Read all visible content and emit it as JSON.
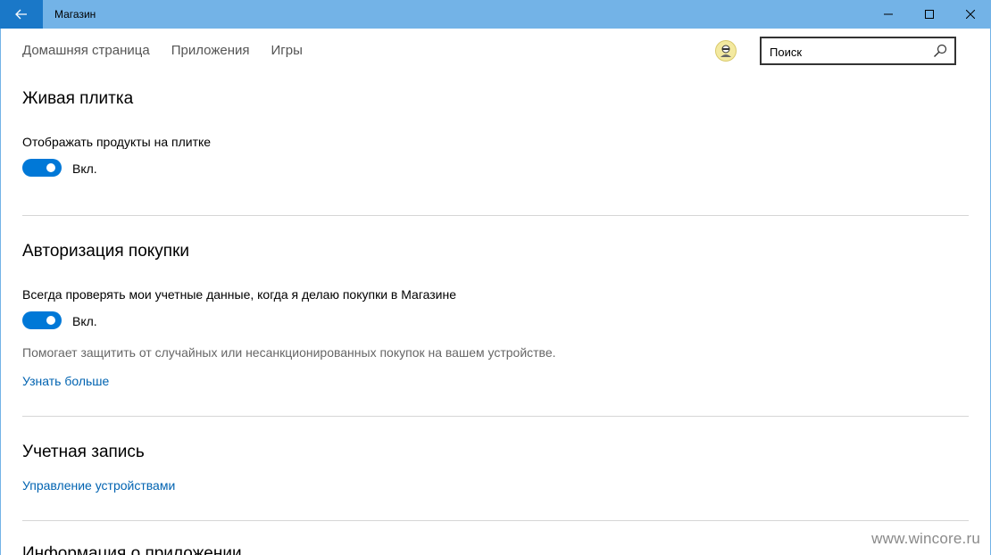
{
  "window": {
    "title": "Магазин",
    "controls": [
      "minimize",
      "maximize",
      "close"
    ]
  },
  "nav": {
    "items": [
      "Домашняя страница",
      "Приложения",
      "Игры"
    ]
  },
  "search": {
    "placeholder": "Поиск"
  },
  "live_tile": {
    "title": "Живая плитка",
    "setting_label": "Отображать продукты на плитке",
    "toggle_state": "Вкл."
  },
  "purchase_auth": {
    "title": "Авторизация покупки",
    "setting_label": "Всегда проверять мои учетные данные, когда я делаю покупки в Магазине",
    "toggle_state": "Вкл.",
    "description": "Помогает защитить от случайных или несанкционированных покупок на вашем устройстве.",
    "learn_more": "Узнать больше"
  },
  "account": {
    "title": "Учетная запись",
    "manage_devices": "Управление устройствами"
  },
  "app_info": {
    "title": "Информация о приложении"
  },
  "watermark": "www.wincore.ru",
  "colors": {
    "titlebar": "#73b3e7",
    "back_button": "#1a78c8",
    "accent": "#0078d7",
    "link": "#0063b1"
  }
}
